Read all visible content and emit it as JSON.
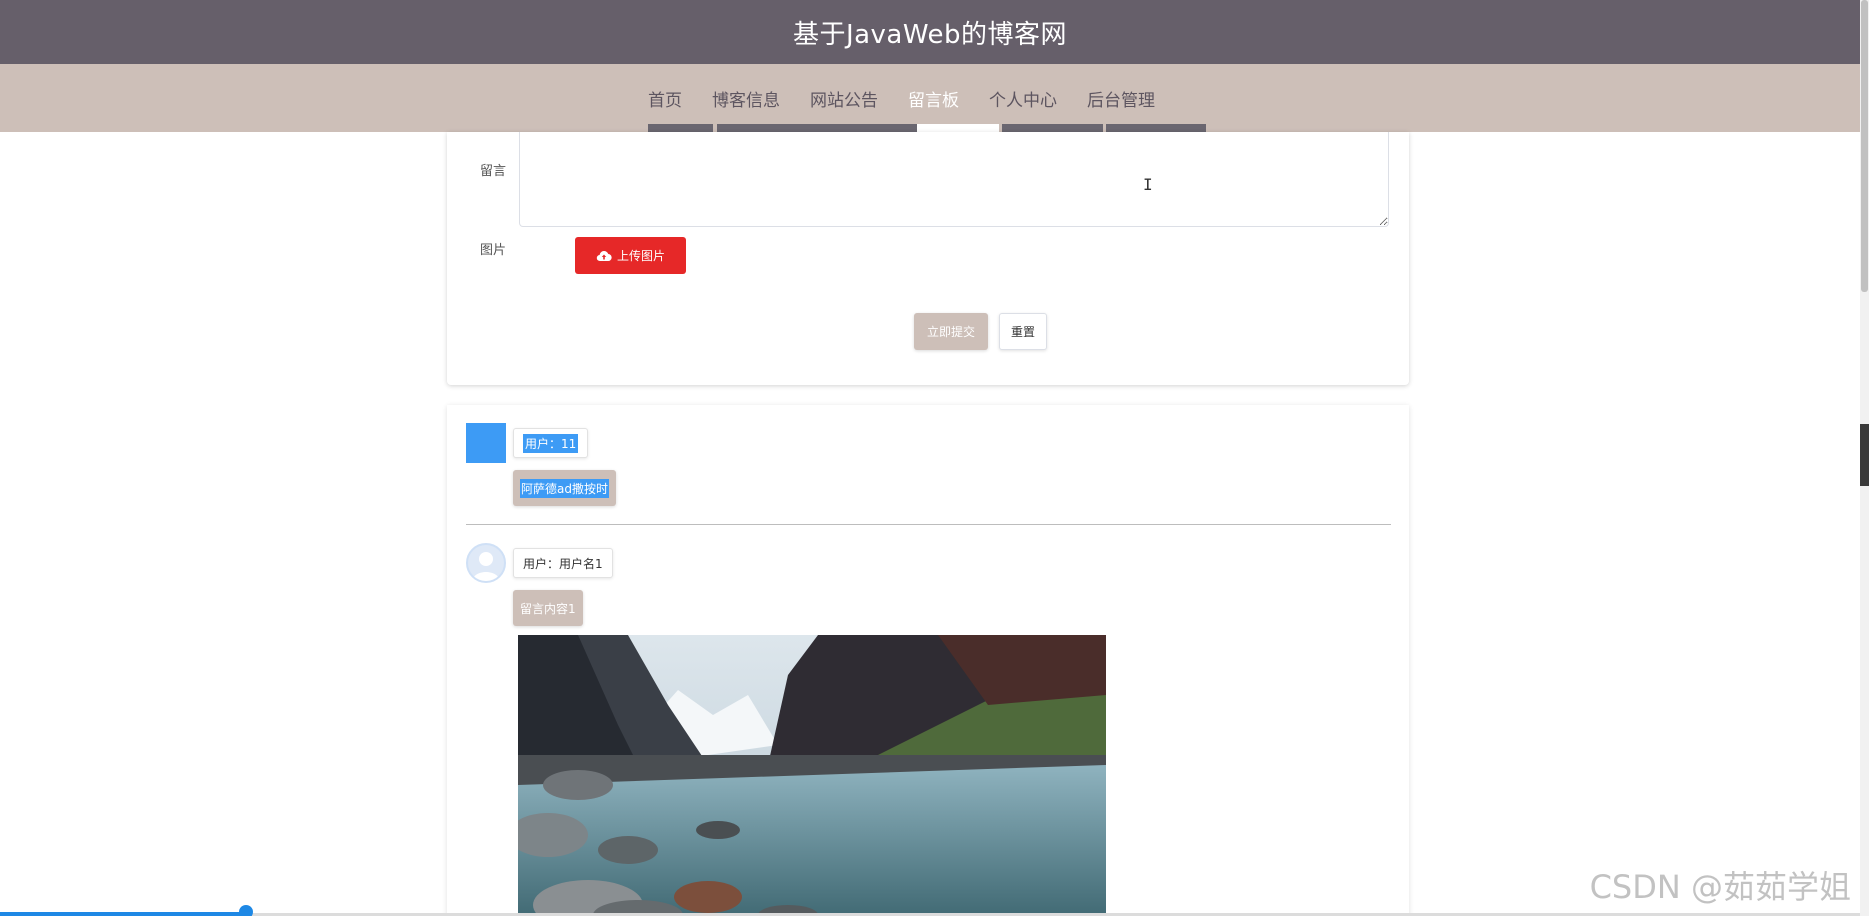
{
  "header": {
    "title": "基于JavaWeb的博客网"
  },
  "nav": {
    "items": [
      {
        "label": "首页"
      },
      {
        "label": "博客信息"
      },
      {
        "label": "网站公告"
      },
      {
        "label": "留言板"
      },
      {
        "label": "个人中心"
      },
      {
        "label": "后台管理"
      }
    ],
    "active_index": 3
  },
  "form": {
    "message_label": "留言",
    "message_value": "",
    "image_label": "图片",
    "upload_label": "上传图片",
    "submit_label": "立即提交",
    "reset_label": "重置"
  },
  "messages": [
    {
      "user_prefix": "用户：",
      "user": "11",
      "content": "阿萨德ad撒按时"
    },
    {
      "user_prefix": "用户：",
      "user": "用户名1",
      "content": "留言内容1"
    }
  ],
  "watermark": "CSDN @茹茹学姐",
  "colors": {
    "header_bg": "#665f6a",
    "nav_bg": "#cdbfb8",
    "upload_button": "#e62828",
    "accent_blue": "#3d9bf5"
  },
  "icons": {
    "upload": "cloud-upload-icon",
    "avatar_default": "user-avatar-icon"
  },
  "video_progress": 0.13
}
